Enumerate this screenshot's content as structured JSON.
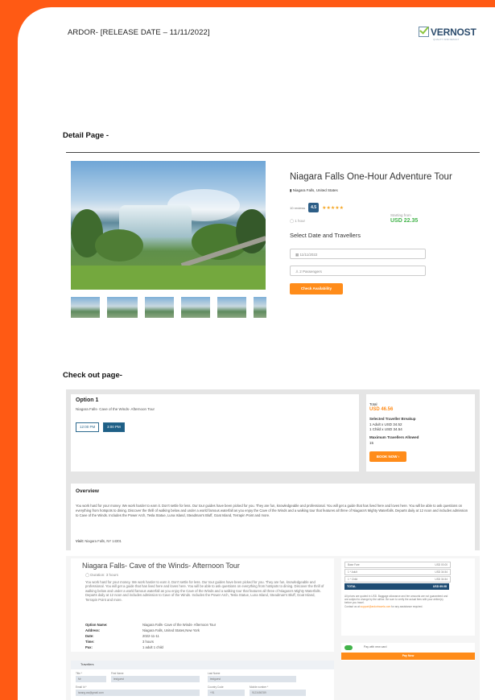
{
  "header": {
    "title": "ARDOR- [RELEASE DATE – 11/11/2022]",
    "logo_text": "VERNOST",
    "logo_tagline": "QUALITY AND RESULT"
  },
  "sections": {
    "detail": "Detail Page -",
    "checkout": "Check out page-"
  },
  "detail": {
    "title": "Niagara Falls One-Hour Adventure Tour",
    "location": "Niagara Falls, United States",
    "reviews": "10 reviews",
    "rating": "4.5",
    "stars": "★★★★★",
    "duration": "1 hour",
    "starting_from_label": "Starting from",
    "starting_price": "USD 22.35",
    "select_label": "Select Date and Travellers",
    "date_value": "11/11/2022",
    "passengers_value": "2 Passengers",
    "check_button": "Check Availability"
  },
  "checkout": {
    "option_title": "Option 1",
    "option_subtitle": "Niagara Falls- Cave of the Winds- Afternoon Tour",
    "times": [
      "12:00 PM",
      "3:00 PM"
    ],
    "selected_time": "3:00 PM",
    "total_label": "Total",
    "total_price": "USD 46.56",
    "breakup_label": "Selected Traveller Breakup",
    "breakup_adult": "1 Adult x USD 34.52",
    "breakup_child": "1 Child x USD 34.54",
    "max_label": "Maximum Travellers Allowed",
    "max_value": "15",
    "book_button": "BOOK NOW ›",
    "overview_title": "Overview",
    "overview_text": "You work hard for your money. We work harder to earn it. Don't settle for less. Our tour guides have been picked for you. They are fun, knowledgeable and professional. You will get a guide that has lived here and loves here. You will be able to ask questions on everything from hotspots to dining. Discover the thrill of walking below and under a world famous waterfall as you enjoy the Cave of the Winds and a walking tour that features all three of Niagara's Mighty Waterfalls. Departs daily at 12 noon and includes admission to Cave of the Winds. Includes the Power Arch, Tesla Statue, Luna Island, Steadman's Bluff, Goat Island, Terrapin Point and more.",
    "visit_label": "Visit:",
    "visit_value": "Niagara Falls, NY 14301"
  },
  "summary": {
    "title": "Niagara Falls- Cave of the Winds- Afternoon Tour",
    "duration": "Duration: 3 hours",
    "text": "You work hard for your money. We work harder to earn it. Don't settle for less. Our tour guides have been picked for you. They are fun, knowledgeable and professional. You will get a guide that has lived here and loves here. You will be able to ask questions on everything from hotspots to dining. Discover the thrill of walking below and under a world famous waterfall as you enjoy the Cave of the Winds and a walking tour that features all three of Niagara's Mighty Waterfalls. Departs daily at 12 noon and includes admission to Cave of the Winds. Includes the Power Arch, Tesla Statue, Luna Island, Steadman's Bluff, Goat Island, Terrapin Point and more.",
    "fields": [
      {
        "k": "Option Name:",
        "v": "Niagara Falls- Cave of the Winds- Afternoon Tour"
      },
      {
        "k": "Address:",
        "v": "Niagara Falls, United States,New York"
      },
      {
        "k": "Date:",
        "v": "2022-11-11"
      },
      {
        "k": "Time:",
        "v": "3 hours"
      },
      {
        "k": "Pax:",
        "v": "1 adult 1 child"
      }
    ],
    "price_rows": [
      {
        "k": "Base Fare",
        "v": "USD 00.00"
      },
      {
        "k": "1 * Adult",
        "v": "USD 34.54"
      },
      {
        "k": "1 * Child",
        "v": "USD 34.54"
      }
    ],
    "total_label": "TOTAL",
    "total_value": "USD 69.08",
    "note": "All prices are quoted in USD. Baggage allowance and fee amounts are not guaranteed and are subject to change by the airline. Be sure to verify the actual fees with your airline(s) before you travel.",
    "contact_prefix": "Contact us at",
    "contact_email": "support@ardortravels.com",
    "contact_suffix": "for any assistance required.",
    "pay_label": "Pay with new card",
    "pay_button": "Pay Now",
    "travellers_label": "Travellers",
    "form_labels": [
      "Title *",
      "First Name",
      "Last Name",
      "Email Id *",
      "Country Code",
      "Mobile number *"
    ],
    "form_values": [
      "Mr",
      "testguest",
      "testguest",
      "tarang.aw@gmail.com",
      "+91",
      "9123456789"
    ]
  }
}
